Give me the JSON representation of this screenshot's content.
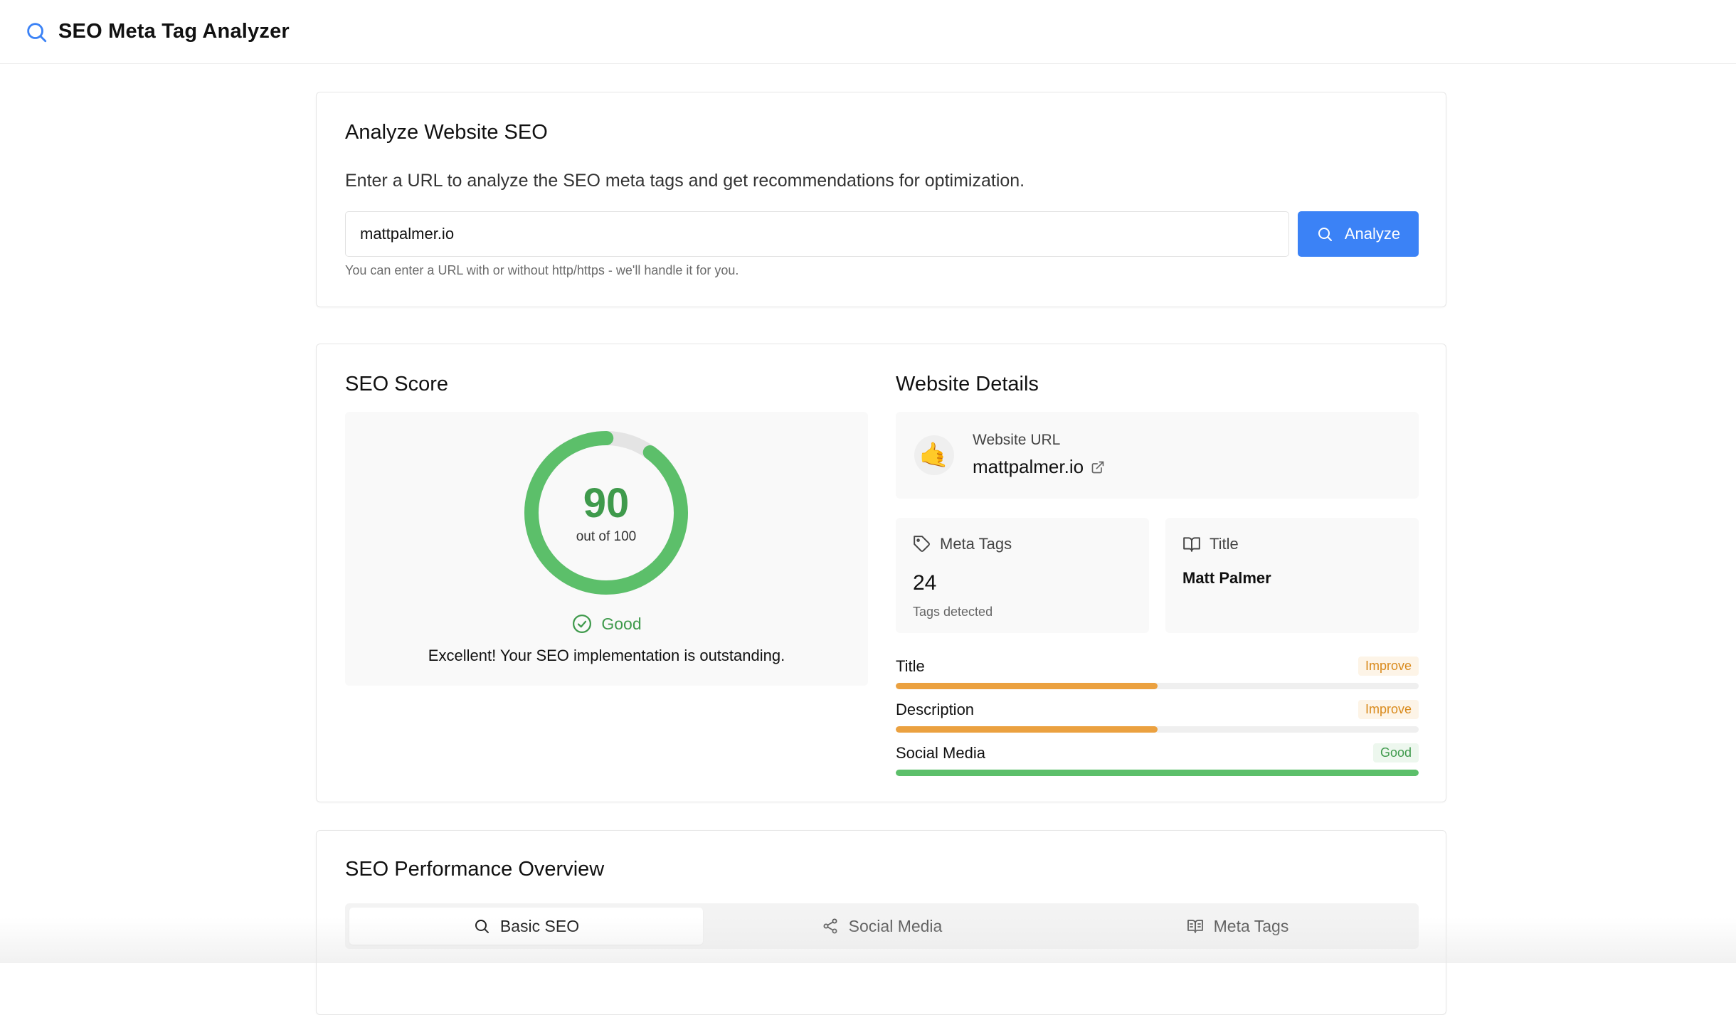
{
  "header": {
    "app_title": "SEO Meta Tag Analyzer"
  },
  "analyze": {
    "title": "Analyze Website SEO",
    "description": "Enter a URL to analyze the SEO meta tags and get recommendations for optimization.",
    "url_value": "mattpalmer.io",
    "button_label": "Analyze",
    "hint": "You can enter a URL with or without http/https - we'll handle it for you."
  },
  "score": {
    "title": "SEO Score",
    "value": "90",
    "value_fraction": 0.9,
    "out_of": "out of 100",
    "rating": "Good",
    "message": "Excellent! Your SEO implementation is outstanding.",
    "color": "#5cbf6a"
  },
  "details": {
    "title": "Website Details",
    "url_label": "Website URL",
    "url_value": "mattpalmer.io",
    "emoji": "🤙",
    "meta_label": "Meta Tags",
    "meta_count": "24",
    "meta_sub": "Tags detected",
    "title_label": "Title",
    "title_value": "Matt Palmer"
  },
  "metrics": [
    {
      "label": "Title",
      "status": "Improve",
      "fraction": 0.5,
      "color": "#eba140"
    },
    {
      "label": "Description",
      "status": "Improve",
      "fraction": 0.5,
      "color": "#eba140"
    },
    {
      "label": "Social Media",
      "status": "Good",
      "fraction": 1.0,
      "color": "#5cbf6a"
    }
  ],
  "overview": {
    "title": "SEO Performance Overview",
    "tabs": [
      {
        "label": "Basic SEO",
        "active": true
      },
      {
        "label": "Social Media",
        "active": false
      },
      {
        "label": "Meta Tags",
        "active": false
      }
    ]
  }
}
